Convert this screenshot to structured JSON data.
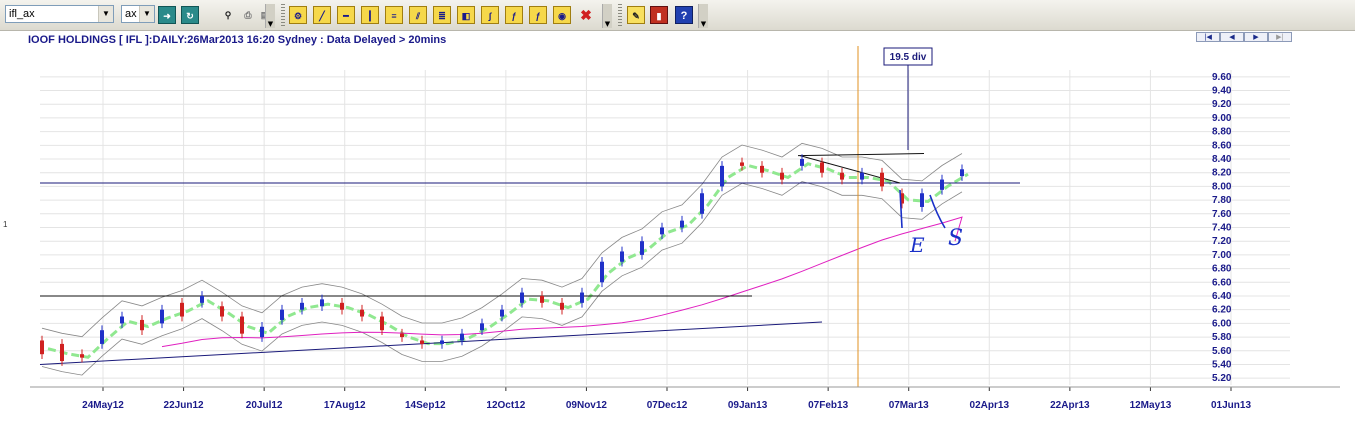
{
  "toolbar": {
    "symbol_value": "ifl_ax",
    "exchange_value": "ax"
  },
  "chart": {
    "title": "IOOF HOLDINGS [ IFL ]:DAILY:26Mar2013 16:20 Sydney : Data Delayed > 20mins",
    "left_axis_marker": "1",
    "annotation": "19.5 div",
    "handwriting": [
      "E",
      "S"
    ]
  },
  "colors": {
    "axis_text": "#1a1a8a",
    "title_text": "#1a1a8a",
    "up_candle": "#2030c8",
    "down_candle": "#d02020",
    "ma_long": "#e020c0",
    "ma_short": "#90e890",
    "bollinger": "#888888",
    "trendline": "#1a1a7a",
    "vertical_marker": "#e09020"
  },
  "chart_data": {
    "type": "candlestick",
    "y_ticks": [
      "9.60",
      "9.40",
      "9.20",
      "9.00",
      "8.80",
      "8.60",
      "8.40",
      "8.20",
      "8.00",
      "7.80",
      "7.60",
      "7.40",
      "7.20",
      "7.00",
      "6.80",
      "6.60",
      "6.40",
      "6.20",
      "6.00",
      "5.80",
      "5.60",
      "5.40",
      "5.20"
    ],
    "ylim": [
      5.1,
      9.7
    ],
    "x_ticks": [
      "24May12",
      "22Jun12",
      "20Jul12",
      "17Aug12",
      "14Sep12",
      "12Oct12",
      "09Nov12",
      "07Dec12",
      "09Jan13",
      "07Feb13",
      "07Mar13",
      "02Apr13",
      "22Apr13",
      "12May13",
      "01Jun13"
    ],
    "price_path": [
      [
        5.75,
        5.55
      ],
      [
        5.7,
        5.45
      ],
      [
        5.55,
        5.5
      ],
      [
        5.7,
        5.9
      ],
      [
        6.0,
        6.1
      ],
      [
        6.05,
        5.9
      ],
      [
        6.0,
        6.2
      ],
      [
        6.3,
        6.1
      ],
      [
        6.3,
        6.4
      ],
      [
        6.25,
        6.1
      ],
      [
        6.1,
        5.85
      ],
      [
        5.8,
        5.95
      ],
      [
        6.05,
        6.2
      ],
      [
        6.2,
        6.3
      ],
      [
        6.25,
        6.35
      ],
      [
        6.3,
        6.2
      ],
      [
        6.2,
        6.1
      ],
      [
        6.1,
        5.9
      ],
      [
        5.85,
        5.8
      ],
      [
        5.75,
        5.7
      ],
      [
        5.7,
        5.75
      ],
      [
        5.75,
        5.85
      ],
      [
        5.9,
        6.0
      ],
      [
        6.1,
        6.2
      ],
      [
        6.3,
        6.45
      ],
      [
        6.4,
        6.3
      ],
      [
        6.3,
        6.2
      ],
      [
        6.3,
        6.45
      ],
      [
        6.6,
        6.9
      ],
      [
        6.9,
        7.05
      ],
      [
        7.0,
        7.2
      ],
      [
        7.3,
        7.4
      ],
      [
        7.4,
        7.5
      ],
      [
        7.6,
        7.9
      ],
      [
        8.0,
        8.3
      ],
      [
        8.35,
        8.3
      ],
      [
        8.3,
        8.2
      ],
      [
        8.2,
        8.1
      ],
      [
        8.3,
        8.4
      ],
      [
        8.35,
        8.2
      ],
      [
        8.2,
        8.1
      ],
      [
        8.1,
        8.2
      ],
      [
        8.2,
        8.0
      ],
      [
        7.9,
        7.75
      ],
      [
        7.7,
        7.9
      ],
      [
        7.95,
        8.1
      ],
      [
        8.15,
        8.25
      ]
    ],
    "horizontal_lines": [
      8.05,
      6.4
    ],
    "trend_lines": [
      [
        5.4,
        6.02
      ],
      [
        8.45,
        8.48
      ]
    ],
    "grid": true
  }
}
